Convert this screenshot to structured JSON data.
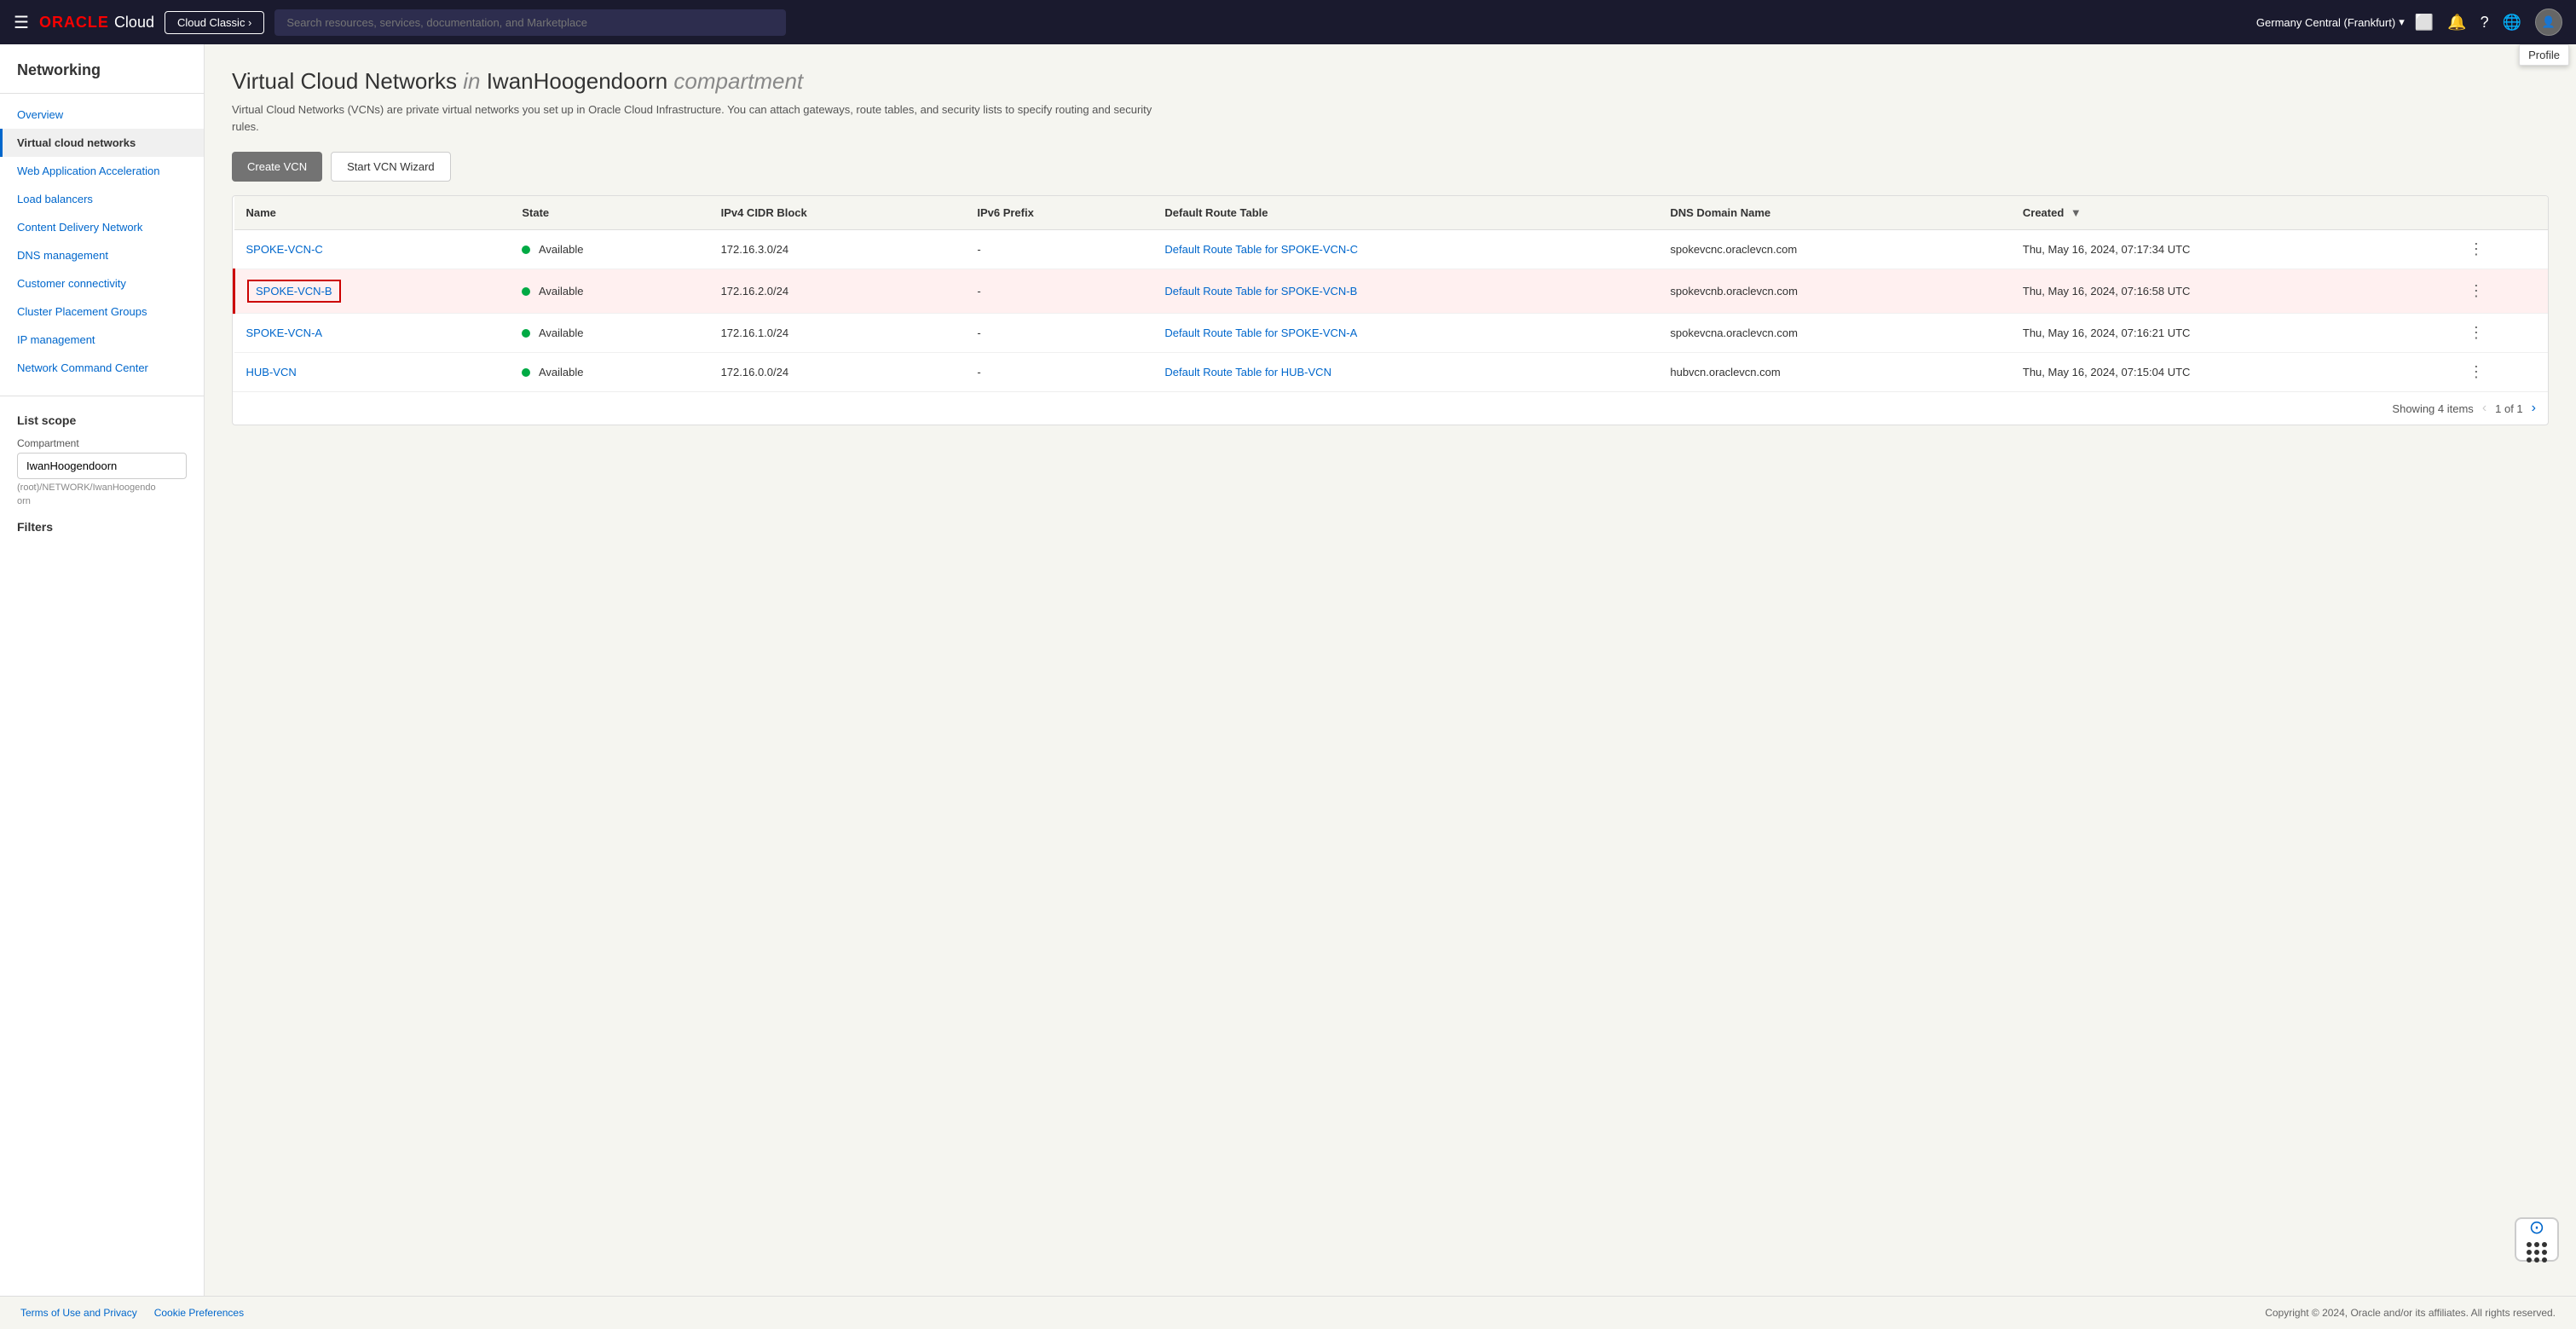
{
  "topnav": {
    "hamburger": "☰",
    "logo_oracle": "ORACLE",
    "logo_cloud": "Cloud",
    "cloud_classic": "Cloud Classic ›",
    "search_placeholder": "Search resources, services, documentation, and Marketplace",
    "region": "Germany Central (Frankfurt)",
    "profile_tooltip": "Profile"
  },
  "sidebar": {
    "title": "Networking",
    "items": [
      {
        "id": "overview",
        "label": "Overview",
        "active": false
      },
      {
        "id": "virtual-cloud-networks",
        "label": "Virtual cloud networks",
        "active": true
      },
      {
        "id": "web-application-acceleration",
        "label": "Web Application Acceleration",
        "active": false
      },
      {
        "id": "load-balancers",
        "label": "Load balancers",
        "active": false
      },
      {
        "id": "content-delivery-network",
        "label": "Content Delivery Network",
        "active": false
      },
      {
        "id": "dns-management",
        "label": "DNS management",
        "active": false
      },
      {
        "id": "customer-connectivity",
        "label": "Customer connectivity",
        "active": false
      },
      {
        "id": "cluster-placement-groups",
        "label": "Cluster Placement Groups",
        "active": false
      },
      {
        "id": "ip-management",
        "label": "IP management",
        "active": false
      },
      {
        "id": "network-command-center",
        "label": "Network Command Center",
        "active": false
      }
    ],
    "list_scope_title": "List scope",
    "compartment_label": "Compartment",
    "compartment_value": "IwanHoogendoorn",
    "compartment_path": "(root)/NETWORK/IwanHoogendo",
    "compartment_path2": "orn",
    "filters_label": "Filters"
  },
  "main": {
    "page_title": "Virtual Cloud Networks",
    "page_title_in": "in",
    "page_title_compartment": "IwanHoogendoorn",
    "page_title_compartment_suffix": "compartment",
    "page_desc": "Virtual Cloud Networks (VCNs) are private virtual networks you set up in Oracle Cloud Infrastructure. You can attach gateways, route tables, and security lists to specify routing and security rules.",
    "btn_create": "Create VCN",
    "btn_wizard": "Start VCN Wizard",
    "table": {
      "columns": [
        {
          "id": "name",
          "label": "Name"
        },
        {
          "id": "state",
          "label": "State"
        },
        {
          "id": "ipv4",
          "label": "IPv4 CIDR Block"
        },
        {
          "id": "ipv6",
          "label": "IPv6 Prefix"
        },
        {
          "id": "route_table",
          "label": "Default Route Table"
        },
        {
          "id": "dns",
          "label": "DNS Domain Name"
        },
        {
          "id": "created",
          "label": "Created",
          "sortable": true
        }
      ],
      "rows": [
        {
          "name": "SPOKE-VCN-C",
          "name_href": "#",
          "state": "Available",
          "ipv4": "172.16.3.0/24",
          "ipv6": "-",
          "route_table": "Default Route Table for SPOKE-VCN-C",
          "dns": "spokevcnc.oraclevcn.com",
          "created": "Thu, May 16, 2024, 07:17:34 UTC",
          "selected": false
        },
        {
          "name": "SPOKE-VCN-B",
          "name_href": "#",
          "state": "Available",
          "ipv4": "172.16.2.0/24",
          "ipv6": "-",
          "route_table": "Default Route Table for SPOKE-VCN-B",
          "dns": "spokevcnb.oraclevcn.com",
          "created": "Thu, May 16, 2024, 07:16:58 UTC",
          "selected": true
        },
        {
          "name": "SPOKE-VCN-A",
          "name_href": "#",
          "state": "Available",
          "ipv4": "172.16.1.0/24",
          "ipv6": "-",
          "route_table": "Default Route Table for SPOKE-VCN-A",
          "dns": "spokevcna.oraclevcn.com",
          "created": "Thu, May 16, 2024, 07:16:21 UTC",
          "selected": false
        },
        {
          "name": "HUB-VCN",
          "name_href": "#",
          "state": "Available",
          "ipv4": "172.16.0.0/24",
          "ipv6": "-",
          "route_table": "Default Route Table for HUB-VCN",
          "dns": "hubvcn.oraclevcn.com",
          "created": "Thu, May 16, 2024, 07:15:04 UTC",
          "selected": false
        }
      ],
      "pagination": {
        "showing": "Showing 4 items",
        "page_info": "1 of 1"
      }
    }
  },
  "footer": {
    "links": [
      "Terms of Use and Privacy",
      "Cookie Preferences"
    ],
    "copyright": "Copyright © 2024, Oracle and/or its affiliates. All rights reserved."
  }
}
